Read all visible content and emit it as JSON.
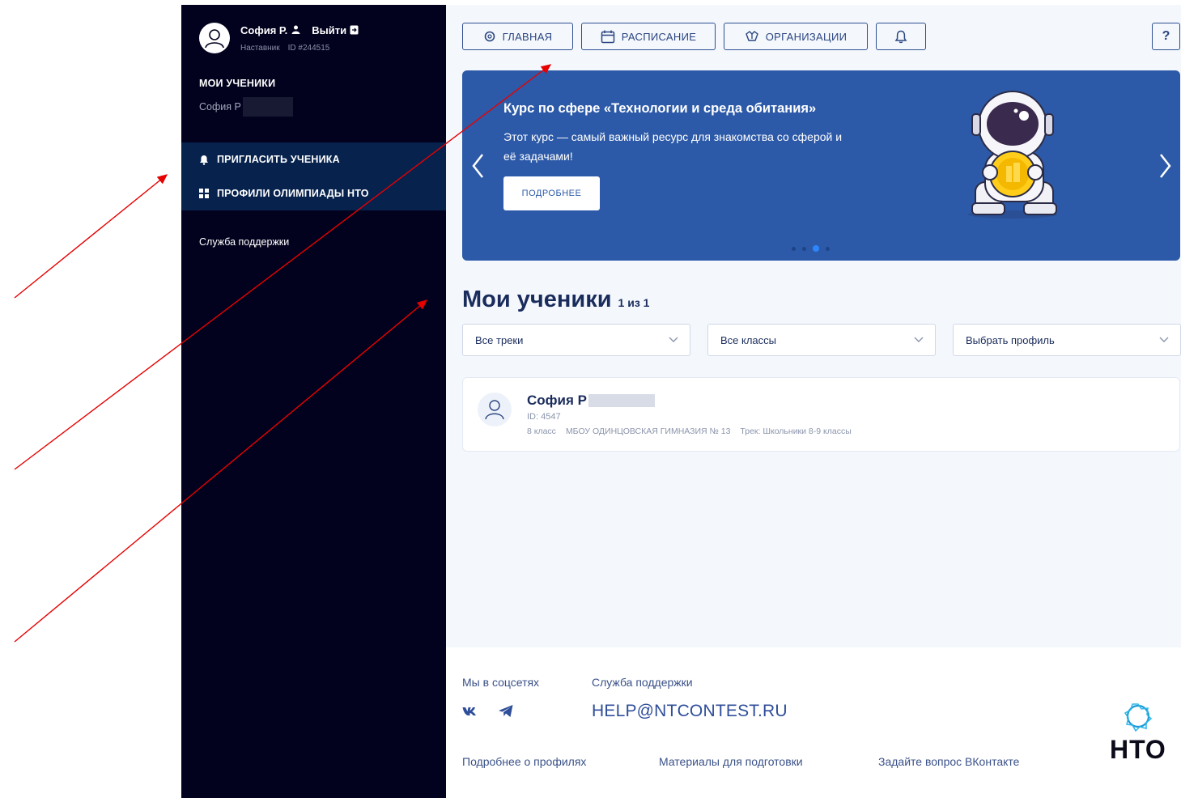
{
  "sidebar": {
    "user_name": "София Р.",
    "logout_label": "Выйти",
    "role": "Наставник",
    "user_id": "ID #244515",
    "section_title": "МОИ УЧЕНИКИ",
    "student_short": "София Р",
    "nav": [
      {
        "label": "ПРИГЛАСИТЬ УЧЕНИКА",
        "icon": "bell-icon"
      },
      {
        "label": "ПРОФИЛИ ОЛИМПИАДЫ НТО",
        "icon": "grid-icon"
      }
    ],
    "support_label": "Служба поддержки"
  },
  "topnav": {
    "items": [
      {
        "label": "ГЛАВНАЯ",
        "icon": "home-icon"
      },
      {
        "label": "РАСПИСАНИЕ",
        "icon": "calendar-icon"
      },
      {
        "label": "ОРГАНИЗАЦИИ",
        "icon": "organizations-icon"
      }
    ],
    "notifications_icon": "bell-icon",
    "help_label": "?"
  },
  "banner": {
    "title": "Курс по сфере «Технологии и среда обитания»",
    "text": "Этот курс — самый важный ресурс для знакомства со сферой и её задачами!",
    "button_label": "ПОДРОБНЕЕ",
    "active_slide": 3,
    "slides": 4
  },
  "students": {
    "title": "Мои ученики",
    "count": "1 из 1",
    "filters": [
      {
        "label": "Все треки"
      },
      {
        "label": "Все классы"
      },
      {
        "label": "Выбрать профиль"
      }
    ],
    "list": [
      {
        "name": "София Р",
        "id": "ID: 4547",
        "grade": "8 класс",
        "school": "МБОУ ОДИНЦОВСКАЯ ГИМНАЗИЯ № 13",
        "track": "Трек: Школьники 8-9 классы"
      }
    ]
  },
  "footer": {
    "social_label": "Мы в соцсетях",
    "support_label": "Служба поддержки",
    "email": "HELP@NTCONTEST.RU",
    "links": [
      "Подробнее о профилях",
      "Материалы для подготовки",
      "Задайте вопрос ВКонтакте"
    ],
    "brand": "НТО"
  },
  "colors": {
    "sidebar_bg": "#02021e",
    "sidebar_highlight": "#06224d",
    "banner_bg": "#2d5aa8",
    "accent": "#2e86ff",
    "annotation": "#e60000"
  }
}
